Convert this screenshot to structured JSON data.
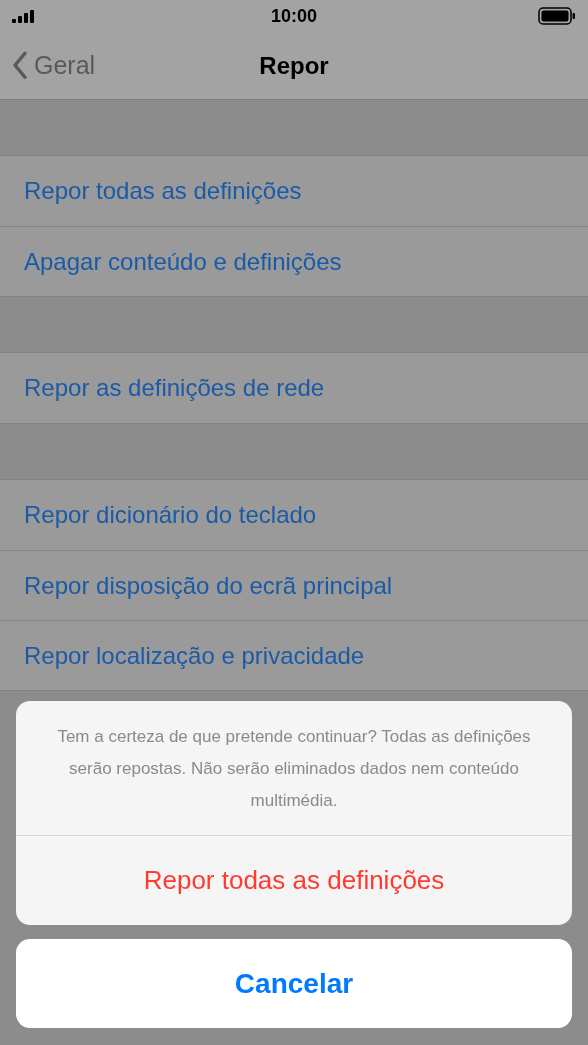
{
  "status_bar": {
    "time": "10:00"
  },
  "nav": {
    "back": "Geral",
    "title": "Repor"
  },
  "groups": [
    {
      "items": [
        "Repor todas as definições",
        "Apagar conteúdo e definições"
      ]
    },
    {
      "items": [
        "Repor as definições de rede"
      ]
    },
    {
      "items": [
        "Repor dicionário do teclado",
        "Repor disposição do ecrã principal",
        "Repor localização e privacidade"
      ]
    }
  ],
  "action_sheet": {
    "message": "Tem a certeza de que pretende continuar? Todas as definições serão repostas. Não serão eliminados dados nem conteúdo multimédia.",
    "actions": [
      {
        "label": "Repor todas as definições",
        "kind": "destructive"
      }
    ],
    "cancel": "Cancelar"
  }
}
